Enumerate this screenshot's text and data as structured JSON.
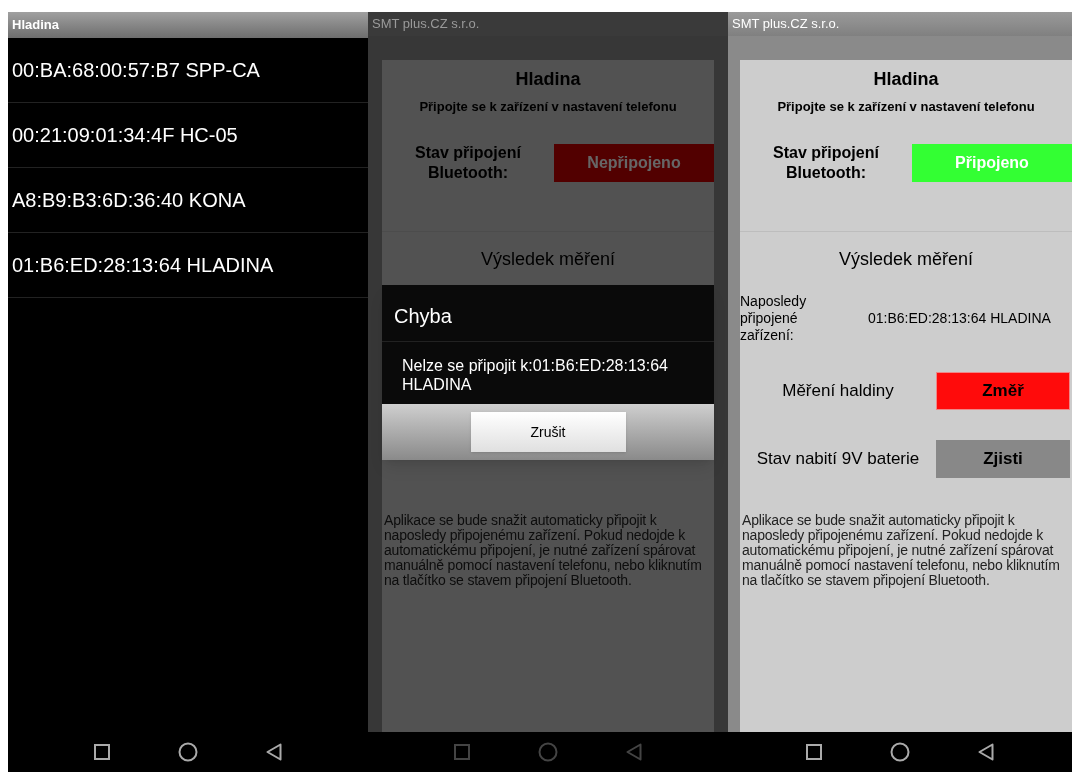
{
  "screens": [
    {
      "kind": "device_list",
      "title": "Hladina",
      "devices": [
        "00:BA:68:00:57:B7 SPP-CA",
        "00:21:09:01:34:4F HC-05",
        "A8:B9:B3:6D:36:40 KONA",
        "01:B6:ED:28:13:64 HLADINA"
      ]
    },
    {
      "kind": "app",
      "dimmed": true,
      "header": "SMT plus.CZ s.r.o.",
      "title": "Hladina",
      "subtitle": "Připojte se k zařízení v nastavení telefonu",
      "status_label": "Stav připojení Bluetooth:",
      "status_button": {
        "label": "Nepřipojeno",
        "connected": false
      },
      "result_heading": "Výsledek měření",
      "info_text": "Aplikace se bude snažit automaticky připojit k naposledy připojenému zařízení. Pokud nedojde k automatickému připojení, je nutné zařízení spárovat manuálně pomocí nastavení telefonu, nebo kliknutím na tlačítko se stavem připojení Bluetooth.",
      "dialog": {
        "title": "Chyba",
        "message": "Nelze se připojit k:01:B6:ED:28:13:64 HLADINA",
        "button": "Zrušit"
      }
    },
    {
      "kind": "app",
      "dimmed": false,
      "header": "SMT plus.CZ s.r.o.",
      "title": "Hladina",
      "subtitle": "Připojte se k zařízení v nastavení telefonu",
      "status_label": "Stav připojení Bluetooth:",
      "status_button": {
        "label": "Připojeno",
        "connected": true
      },
      "result_heading": "Výsledek měření",
      "last_device_label": "Naposledy připojené zařízení:",
      "last_device_value": "01:B6:ED:28:13:64 HLADINA",
      "measure_label": "Měření haldiny",
      "measure_button": "Změř",
      "battery_label": "Stav nabití 9V baterie",
      "battery_button": "Zjisti",
      "info_text": "Aplikace se bude snažit automaticky připojit k naposledy připojenému zařízení. Pokud nedojde k automatickému připojení, je nutné zařízení spárovat manuálně pomocí nastavení telefonu, nebo kliknutím na tlačítko se stavem připojení Bluetooth."
    }
  ]
}
